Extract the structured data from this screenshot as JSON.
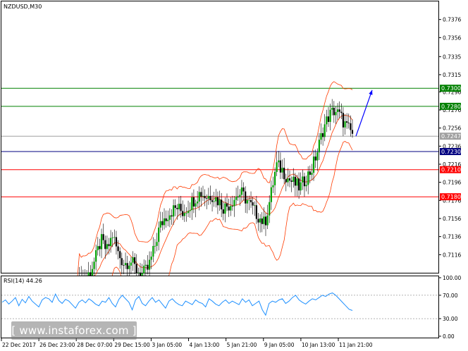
{
  "chart_data": {
    "type": "candlestick",
    "symbol_label": "NZDUSD,M30",
    "price_axis": {
      "ylim": [
        0.7096,
        0.7396
      ],
      "ticks": [
        "0.7376",
        "0.7356",
        "0.7335",
        "0.7315",
        "0.7296",
        "0.7276",
        "0.7256",
        "0.7236",
        "0.7216",
        "0.7196",
        "0.7176",
        "0.7156",
        "0.7136",
        "0.7116"
      ]
    },
    "price_levels": [
      {
        "label": "0.7300",
        "value": 0.73,
        "color": "#008000"
      },
      {
        "label": "0.7280",
        "value": 0.728,
        "color": "#008000"
      },
      {
        "label": "0.7247",
        "value": 0.7247,
        "color": "#a0a0a0"
      },
      {
        "label": "0.7230",
        "value": 0.723,
        "color": "#000080"
      },
      {
        "label": "0.7210",
        "value": 0.721,
        "color": "#ff0000"
      },
      {
        "label": "0.7180",
        "value": 0.718,
        "color": "#ff0000"
      }
    ],
    "time_axis": {
      "labels": [
        "22 Dec 2017",
        "26 Dec 23:00",
        "28 Dec 07:00",
        "29 Dec 15:00",
        "3 Jan 05:00",
        "4 Jan 13:00",
        "5 Jan 21:00",
        "9 Jan 05:00",
        "10 Jan 13:00",
        "11 Jan 21:00"
      ]
    },
    "price_path": [
      0.7084,
      0.709,
      0.7095,
      0.711,
      0.7132,
      0.712,
      0.7138,
      0.7116,
      0.7106,
      0.711,
      0.71,
      0.7094,
      0.71,
      0.712,
      0.7146,
      0.7158,
      0.7164,
      0.7168,
      0.7163,
      0.717,
      0.7178,
      0.7185,
      0.718,
      0.7182,
      0.7176,
      0.7168,
      0.7172,
      0.718,
      0.7184,
      0.7176,
      0.7166,
      0.7158,
      0.715,
      0.718,
      0.7215,
      0.721,
      0.72,
      0.7195,
      0.719,
      0.72,
      0.721,
      0.723,
      0.7255,
      0.727,
      0.7276,
      0.7268,
      0.7257,
      0.725
    ],
    "trend_arrow": {
      "from": [
        0.7247,
        0.725
      ],
      "to": [
        0.7298,
        0.73
      ],
      "color": "#0000ff"
    },
    "rsi": {
      "label": "RSI(14) 44.26",
      "ylim": [
        0,
        100
      ],
      "ticks": [
        "100.00",
        "70.00",
        "30.00",
        "0.00"
      ],
      "levels": [
        70,
        30
      ],
      "values": [
        58,
        62,
        55,
        60,
        66,
        52,
        63,
        57,
        68,
        60,
        55,
        50,
        62,
        66,
        64,
        58,
        72,
        61,
        56,
        63,
        60,
        54,
        48,
        58,
        62,
        57,
        64,
        60,
        55,
        52,
        60,
        58,
        66,
        56,
        50,
        63,
        70,
        64,
        58,
        45,
        62,
        68,
        56,
        52,
        60,
        66,
        58,
        62,
        55,
        48,
        60,
        64,
        58,
        54,
        52,
        60,
        57,
        54,
        62,
        58,
        56,
        50,
        64,
        60,
        55,
        52,
        58,
        62,
        56,
        60,
        57,
        54,
        64,
        58,
        62,
        52,
        56,
        60,
        45,
        36,
        56,
        60,
        58,
        62,
        64,
        56,
        60,
        66,
        70,
        62,
        58,
        55,
        60,
        64,
        62,
        66,
        70,
        68,
        72,
        74,
        70,
        64,
        58,
        52,
        46,
        44
      ]
    }
  },
  "watermark": {
    "text": "[  www.instaforex.com  ]"
  }
}
